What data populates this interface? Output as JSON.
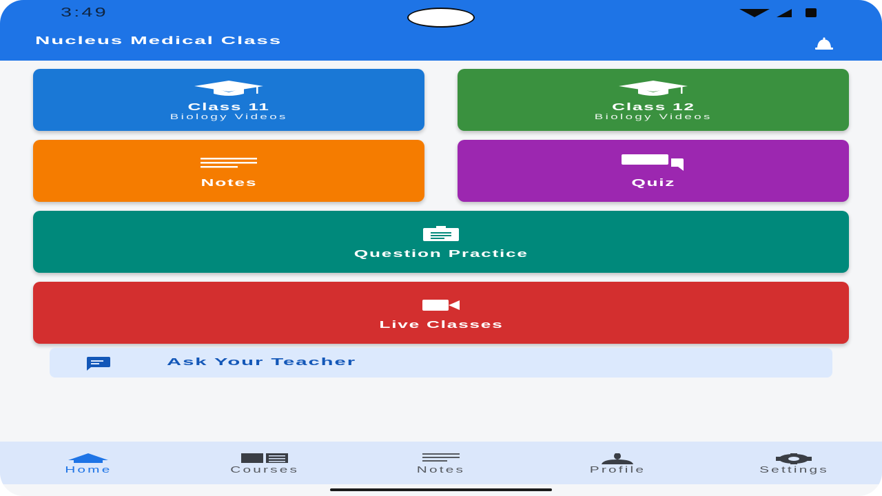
{
  "status_bar": {
    "time": "3:49"
  },
  "app_bar": {
    "title": "Nucleus Medical Class"
  },
  "tiles": {
    "class11": {
      "title": "Class 11",
      "subtitle": "Biology Videos",
      "icon": "graduation-cap-icon"
    },
    "class12": {
      "title": "Class 12",
      "subtitle": "Biology Videos",
      "icon": "graduation-cap-icon"
    },
    "notes": {
      "title": "Notes",
      "icon": "notes-lines-icon"
    },
    "quiz": {
      "title": "Quiz",
      "icon": "chat-bubbles-icon"
    },
    "question_practice": {
      "title": "Question Practice",
      "icon": "clipboard-icon"
    },
    "live_classes": {
      "title": "Live Classes",
      "icon": "video-camera-icon"
    }
  },
  "ask_teacher": {
    "label": "Ask Your Teacher",
    "icon": "message-icon"
  },
  "bottom_nav": [
    {
      "label": "Home",
      "icon": "home-icon",
      "active": true
    },
    {
      "label": "Courses",
      "icon": "book-icon",
      "active": false
    },
    {
      "label": "Notes",
      "icon": "notes-icon",
      "active": false
    },
    {
      "label": "Profile",
      "icon": "person-icon",
      "active": false
    },
    {
      "label": "Settings",
      "icon": "gear-icon",
      "active": false
    }
  ],
  "colors": {
    "app_bar": "#1e74e6",
    "class11": "#1a78d6",
    "class12": "#3a913f",
    "notes": "#f57c00",
    "quiz": "#9c27b0",
    "question_practice": "#00897b",
    "live_classes": "#d32f2f",
    "ask_bg": "#dce9fd",
    "ask_text": "#1357b8",
    "nav_bg": "#dbe7fb",
    "nav_active": "#1e74e6"
  }
}
